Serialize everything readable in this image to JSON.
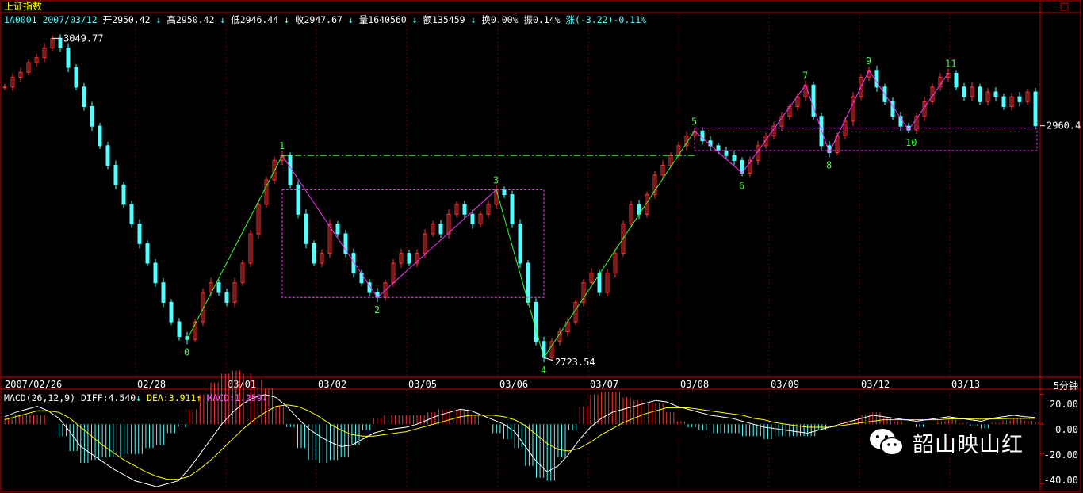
{
  "window": {
    "title": "上证指数",
    "info_line": {
      "code_date": "1A0001  2007/03/12",
      "open": "开2950.42",
      "high": "高2950.42",
      "low": "低2946.44",
      "close": "收2947.67",
      "volume": "量1640560",
      "amount": "额135459",
      "turnover": "换0.00%",
      "amplitude": "振0.14%",
      "change": "涨(-3.22)-0.11%"
    },
    "period_label": "5分钟",
    "watermark": "韶山映山红"
  },
  "macd_panel": {
    "label": "MACD(26,12,9)",
    "diff": "DIFF:4.540",
    "dea": "DEA:3.911",
    "macd": "MACD:1.259",
    "y_ticks": [
      "20.00",
      "0.00",
      "-20.00",
      "-40.00"
    ]
  },
  "colors": {
    "background": "#000000",
    "frame": "#cc0000",
    "up_candle": "#ff3333",
    "down_candle": "#54ffff",
    "wave_magenta": "#ff33ff",
    "wave_green": "#33ff33",
    "labels_green": "#33ff33",
    "diff_line": "#ffffff",
    "dea_line": "#ffff00"
  },
  "chart_data": {
    "type": "line",
    "title": "上证指数",
    "x_categories": [
      "2007/02/26",
      "02/28",
      "03/01",
      "03/02",
      "03/05",
      "03/06",
      "03/07",
      "03/08",
      "03/09",
      "03/12",
      "03/13"
    ],
    "price_annotations": {
      "high_marker": "3049.77",
      "low_marker": "2723.54",
      "last_price": "2960.4"
    },
    "ylim": [
      2705,
      3063
    ],
    "wave_points": [
      {
        "label": "0",
        "x": "02/28",
        "y": 2742
      },
      {
        "label": "1",
        "x": "03/01",
        "y": 2930
      },
      {
        "label": "2",
        "x": "03/01",
        "y": 2785
      },
      {
        "label": "3",
        "x": "03/05",
        "y": 2895
      },
      {
        "label": "4",
        "x": "03/05",
        "y": 2723.54
      },
      {
        "label": "5",
        "x": "03/07",
        "y": 2955
      },
      {
        "label": "6",
        "x": "03/08",
        "y": 2912
      },
      {
        "label": "7",
        "x": "03/09",
        "y": 3002
      },
      {
        "label": "8",
        "x": "03/09",
        "y": 2933
      },
      {
        "label": "9",
        "x": "03/09",
        "y": 3017
      },
      {
        "label": "10",
        "x": "03/12",
        "y": 2956
      },
      {
        "label": "11",
        "x": "03/12",
        "y": 3014
      }
    ],
    "price_path": [
      3000,
      3010,
      3015,
      3025,
      3030,
      3040,
      3049.77,
      3040,
      3020,
      3000,
      2980,
      2960,
      2940,
      2920,
      2900,
      2880,
      2860,
      2840,
      2820,
      2800,
      2780,
      2760,
      2745,
      2742,
      2760,
      2790,
      2800,
      2790,
      2780,
      2800,
      2820,
      2850,
      2880,
      2905,
      2925,
      2930,
      2900,
      2870,
      2840,
      2820,
      2830,
      2860,
      2850,
      2830,
      2810,
      2800,
      2790,
      2785,
      2800,
      2820,
      2830,
      2820,
      2830,
      2850,
      2860,
      2850,
      2870,
      2880,
      2870,
      2860,
      2870,
      2880,
      2895,
      2890,
      2860,
      2820,
      2780,
      2740,
      2723.54,
      2740,
      2750,
      2760,
      2780,
      2800,
      2810,
      2790,
      2810,
      2830,
      2860,
      2880,
      2870,
      2890,
      2910,
      2920,
      2930,
      2940,
      2950,
      2955,
      2945,
      2940,
      2935,
      2930,
      2925,
      2912,
      2925,
      2940,
      2950,
      2960,
      2970,
      2980,
      2990,
      3002,
      2970,
      2940,
      2933,
      2950,
      2965,
      2990,
      3010,
      3017,
      3000,
      2985,
      2970,
      2960,
      2956,
      2970,
      2985,
      3000,
      3010,
      3014,
      3000,
      2990,
      3000,
      2985,
      2995,
      2990,
      2980,
      2990,
      2985,
      2995,
      2960.4
    ],
    "macd": {
      "ylim": [
        -43,
        23
      ],
      "diff": [
        5,
        8,
        10,
        12,
        9,
        4,
        -5,
        -15,
        -20,
        -25,
        -30,
        -34,
        -38,
        -40,
        -42,
        -40,
        -38,
        -30,
        -20,
        -10,
        0,
        8,
        14,
        18,
        20,
        18,
        12,
        4,
        -3,
        -8,
        -12,
        -15,
        -14,
        -10,
        -6,
        -4,
        -3,
        -2,
        0,
        3,
        6,
        8,
        10,
        9,
        6,
        3,
        0,
        -5,
        -15,
        -25,
        -32,
        -28,
        -20,
        -10,
        -2,
        4,
        8,
        10,
        12,
        14,
        16,
        15,
        12,
        10,
        8,
        6,
        5,
        4,
        2,
        0,
        -2,
        -3,
        -4,
        -5,
        -6,
        -4,
        -2,
        0,
        2,
        4,
        6,
        5,
        4,
        3,
        2,
        3,
        4,
        5,
        4,
        3,
        2,
        4,
        5,
        6,
        5,
        4.54
      ],
      "dea": [
        3,
        5,
        7,
        9,
        9,
        8,
        4,
        -2,
        -8,
        -14,
        -19,
        -24,
        -28,
        -32,
        -35,
        -37,
        -37,
        -35,
        -30,
        -24,
        -17,
        -10,
        -3,
        3,
        8,
        12,
        13,
        12,
        9,
        5,
        0,
        -4,
        -7,
        -8,
        -8,
        -7,
        -6,
        -5,
        -3,
        -1,
        1,
        3,
        5,
        6,
        6,
        6,
        5,
        3,
        -1,
        -7,
        -13,
        -17,
        -18,
        -16,
        -12,
        -7,
        -3,
        1,
        4,
        7,
        9,
        11,
        11,
        11,
        10,
        9,
        8,
        7,
        6,
        4,
        3,
        1,
        0,
        -1,
        -2,
        -2,
        -2,
        -1,
        0,
        1,
        2,
        3,
        3,
        3,
        3,
        3,
        3,
        3.5,
        3.6,
        3.5,
        3.4,
        3.5,
        3.7,
        3.9,
        3.9,
        3.911
      ]
    }
  }
}
